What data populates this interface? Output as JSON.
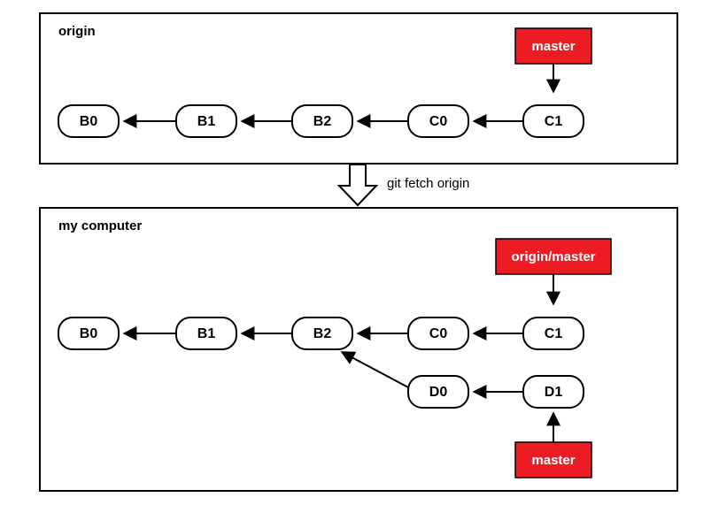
{
  "topPanel": {
    "title": "origin",
    "commits": [
      "B0",
      "B1",
      "B2",
      "C0",
      "C1"
    ],
    "branch": {
      "label": "master"
    }
  },
  "command": "git fetch origin",
  "bottomPanel": {
    "title": "my computer",
    "mainCommits": [
      "B0",
      "B1",
      "B2",
      "C0",
      "C1"
    ],
    "localCommits": [
      "D0",
      "D1"
    ],
    "remoteBranch": {
      "label": "origin/master"
    },
    "localBranch": {
      "label": "master"
    }
  }
}
